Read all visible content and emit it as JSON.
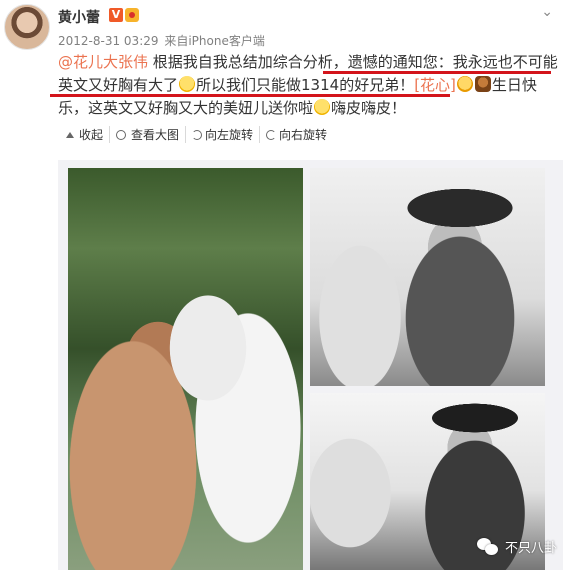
{
  "header": {
    "username": "黄小蕾",
    "verified_badge": "V",
    "time": "2012-8-31 03:29",
    "from_label": "来自",
    "source": "iPhone客户端",
    "menu_icon": "chevron-down-icon"
  },
  "post": {
    "mention": "@花儿大张伟",
    "seg1": " 根据我自我总结加综合分析，遗憾的通知您：我永远也不可能英文又好胸有大了",
    "seg2": "所以我们只能做1314的好兄弟！",
    "emoji_text": "[花心]",
    "seg3": "生日快乐，这英文又好胸又大的美妞儿送你啦",
    "seg4": "嗨皮嗨皮！"
  },
  "toolbar": {
    "collapse": "收起",
    "view_large": "查看大图",
    "rotate_left": "向左旋转",
    "rotate_right": "向右旋转"
  },
  "images": {
    "left": "photo-woman-with-white-horse",
    "top_right": "photo-woman-in-hat-with-horse-bw",
    "bottom_right": "photo-woman-in-hat-with-horse-bw-2"
  },
  "watermark": "不只八卦",
  "colors": {
    "link": "#eb7350",
    "underline": "#d3141b",
    "text": "#333333",
    "meta": "#808080"
  }
}
